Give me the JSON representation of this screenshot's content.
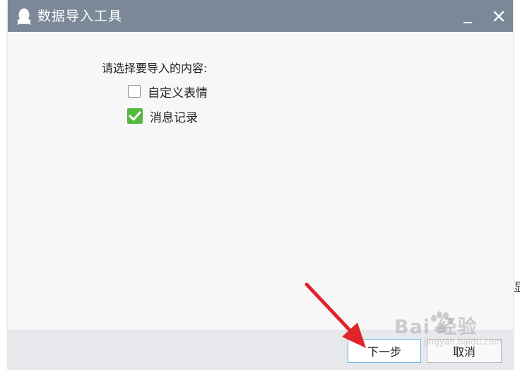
{
  "window": {
    "title": "数据导入工具",
    "icon": "qq-penguin-icon"
  },
  "controls": {
    "minimize_icon": "minimize-icon",
    "close_icon": "close-icon",
    "close_glyph": "✕"
  },
  "content": {
    "prompt": "请选择要导入的内容:",
    "options": [
      {
        "label": "自定义表情",
        "checked": false
      },
      {
        "label": "消息记录",
        "checked": true
      }
    ]
  },
  "footer": {
    "next_label": "下一步",
    "cancel_label": "取消"
  },
  "background": {
    "partial_glyph": "显"
  },
  "watermark": {
    "brand": "Bai  经验",
    "sub": "jingyan.baidu.com"
  },
  "colors": {
    "titlebar": "#7b8898",
    "checked": "#55b93f",
    "primary_border": "#64b5e6",
    "annotation_arrow": "#e0242b"
  }
}
